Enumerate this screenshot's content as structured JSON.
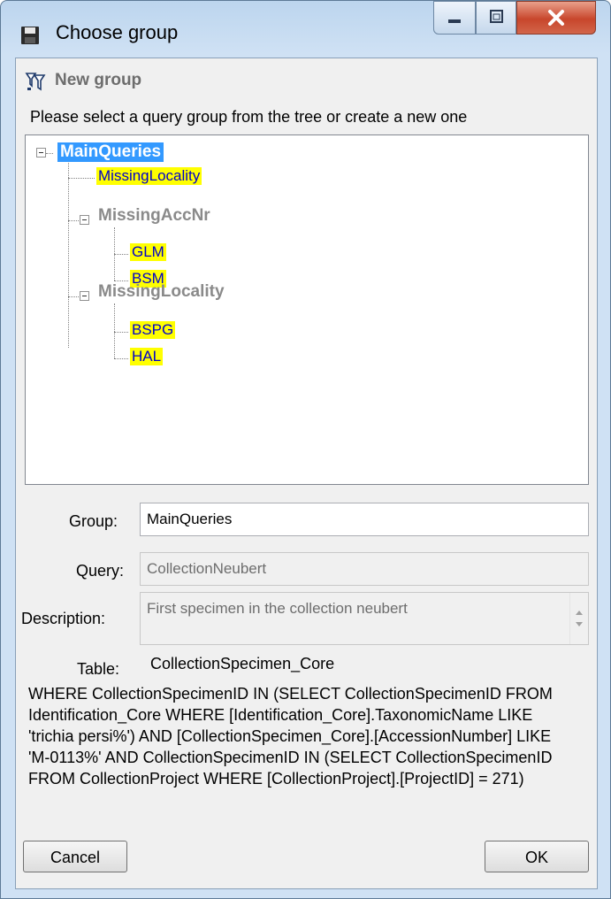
{
  "window": {
    "title": "Choose group",
    "title_icon": "floppy-disk-icon",
    "controls": [
      "minimize-icon",
      "maximize-icon",
      "close-icon"
    ]
  },
  "new_group": {
    "icon": "query-group-icon",
    "label": "New group"
  },
  "instruction": "Please select a query group from the tree or create a new one",
  "tree": {
    "root": {
      "label": "MainQueries",
      "selected": true
    },
    "root_query": "MissingLocality",
    "groups": [
      {
        "label": "MissingAccNr",
        "queries": [
          "GLM",
          "BSM"
        ]
      },
      {
        "label": "MissingLocality",
        "queries": [
          "BSPG",
          "HAL"
        ]
      }
    ]
  },
  "form": {
    "group_label": "Group:",
    "group_value": "MainQueries",
    "query_label": "Query:",
    "query_value": "CollectionNeubert",
    "description_label": "Description:",
    "description_value": "First specimen in the collection neubert",
    "table_label": "Table:",
    "table_value": "CollectionSpecimen_Core"
  },
  "sql": " WHERE CollectionSpecimenID IN (SELECT CollectionSpecimenID FROM Identification_Core WHERE [Identification_Core].TaxonomicName LIKE 'trichia persi%') AND [CollectionSpecimen_Core].[AccessionNumber] LIKE 'M-0113%' AND CollectionSpecimenID IN (SELECT CollectionSpecimenID FROM CollectionProject WHERE [CollectionProject].[ProjectID] = 271)",
  "buttons": {
    "cancel": "Cancel",
    "ok": "OK"
  },
  "colors": {
    "selection": "#3399ff",
    "highlight": "#ffff00",
    "query_text": "#0000cc",
    "group_text": "#8a8a8a",
    "close_button": "#c8462c"
  }
}
